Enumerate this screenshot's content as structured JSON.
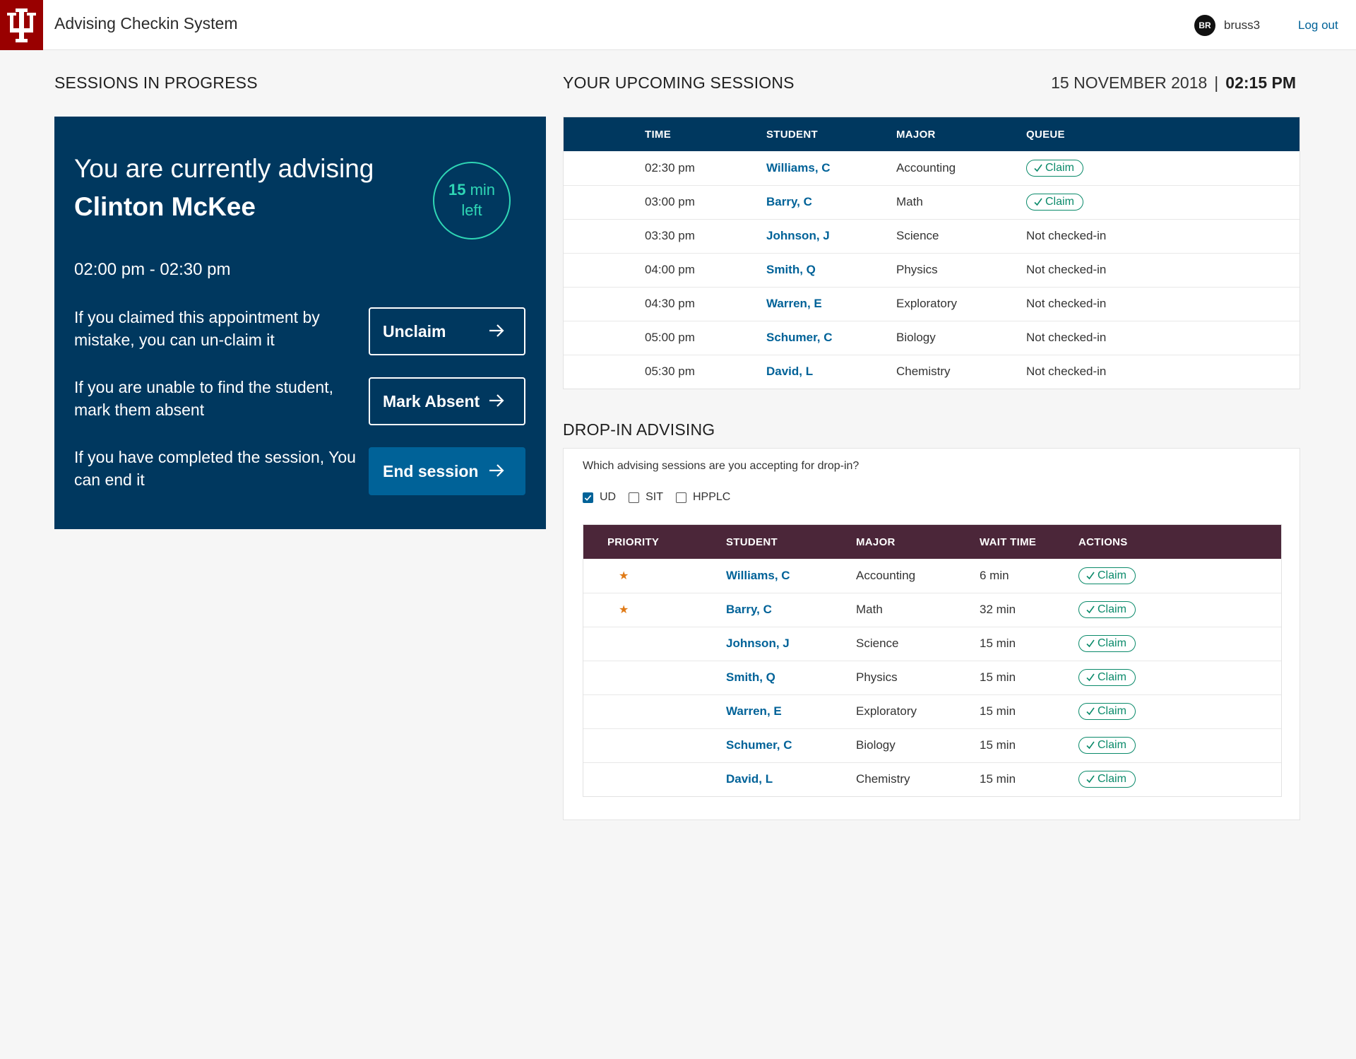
{
  "header": {
    "app_title": "Advising Checkin System",
    "user_initials": "BR",
    "username": "bruss3",
    "logout_label": "Log out"
  },
  "sessions_in_progress": {
    "title": "SESSIONS IN PROGRESS",
    "advising_prefix": "You are currently advising",
    "student_name": "Clinton McKee",
    "timer_value": "15",
    "timer_unit": "min",
    "timer_suffix": "left",
    "session_time": "02:00 pm - 02:30 pm",
    "unclaim_text": "If you claimed this appointment by mistake, you can un-claim it",
    "unclaim_label": "Unclaim",
    "absent_text": "If you are unable to find the student, mark them absent",
    "absent_label": "Mark Absent",
    "end_text": "If you have completed the session, You can end it",
    "end_label": "End session"
  },
  "upcoming": {
    "title": "YOUR UPCOMING SESSIONS",
    "date": "15 NOVEMBER 2018",
    "separator": "|",
    "time": "02:15 PM",
    "columns": [
      "TIME",
      "STUDENT",
      "MAJOR",
      "QUEUE"
    ],
    "claim_label": "Claim",
    "rows": [
      {
        "time": "02:30 pm",
        "student": "Williams, C",
        "major": "Accounting",
        "queue": "Claim"
      },
      {
        "time": "03:00 pm",
        "student": "Barry, C",
        "major": "Math",
        "queue": "Claim"
      },
      {
        "time": "03:30 pm",
        "student": "Johnson, J",
        "major": "Science",
        "queue": "Not checked-in"
      },
      {
        "time": "04:00 pm",
        "student": "Smith, Q",
        "major": "Physics",
        "queue": "Not checked-in"
      },
      {
        "time": "04:30 pm",
        "student": "Warren, E",
        "major": "Exploratory",
        "queue": "Not checked-in"
      },
      {
        "time": "05:00 pm",
        "student": "Schumer, C",
        "major": "Biology",
        "queue": "Not checked-in"
      },
      {
        "time": "05:30 pm",
        "student": "David, L",
        "major": "Chemistry",
        "queue": "Not checked-in"
      }
    ]
  },
  "dropin": {
    "title": "DROP-IN ADVISING",
    "question": "Which advising sessions are you accepting for drop-in?",
    "filters": [
      {
        "label": "UD",
        "checked": true
      },
      {
        "label": "SIT",
        "checked": false
      },
      {
        "label": "HPPLC",
        "checked": false
      }
    ],
    "columns": [
      "PRIORITY",
      "STUDENT",
      "MAJOR",
      "WAIT TIME",
      "ACTIONS"
    ],
    "claim_label": "Claim",
    "rows": [
      {
        "priority": true,
        "student": "Williams, C",
        "major": "Accounting",
        "wait": "6 min"
      },
      {
        "priority": true,
        "student": "Barry, C",
        "major": "Math",
        "wait": "32 min"
      },
      {
        "priority": false,
        "student": "Johnson, J",
        "major": "Science",
        "wait": "15 min"
      },
      {
        "priority": false,
        "student": "Smith, Q",
        "major": "Physics",
        "wait": "15 min"
      },
      {
        "priority": false,
        "student": "Warren, E",
        "major": "Exploratory",
        "wait": "15 min"
      },
      {
        "priority": false,
        "student": "Schumer, C",
        "major": "Biology",
        "wait": "15 min"
      },
      {
        "priority": false,
        "student": "David, L",
        "major": "Chemistry",
        "wait": "15 min"
      }
    ]
  },
  "colors": {
    "brand": "#990000",
    "navy": "#00385f",
    "accent_blue": "#006298",
    "teal": "#2fd6b5",
    "claim_green": "#0a8a6a",
    "dropin_header": "#4b2639",
    "star": "#e07a16"
  },
  "icons": {
    "logo": "iu-trident-logo",
    "arrow": "arrow-right-icon",
    "check": "check-icon",
    "star": "star-icon"
  }
}
